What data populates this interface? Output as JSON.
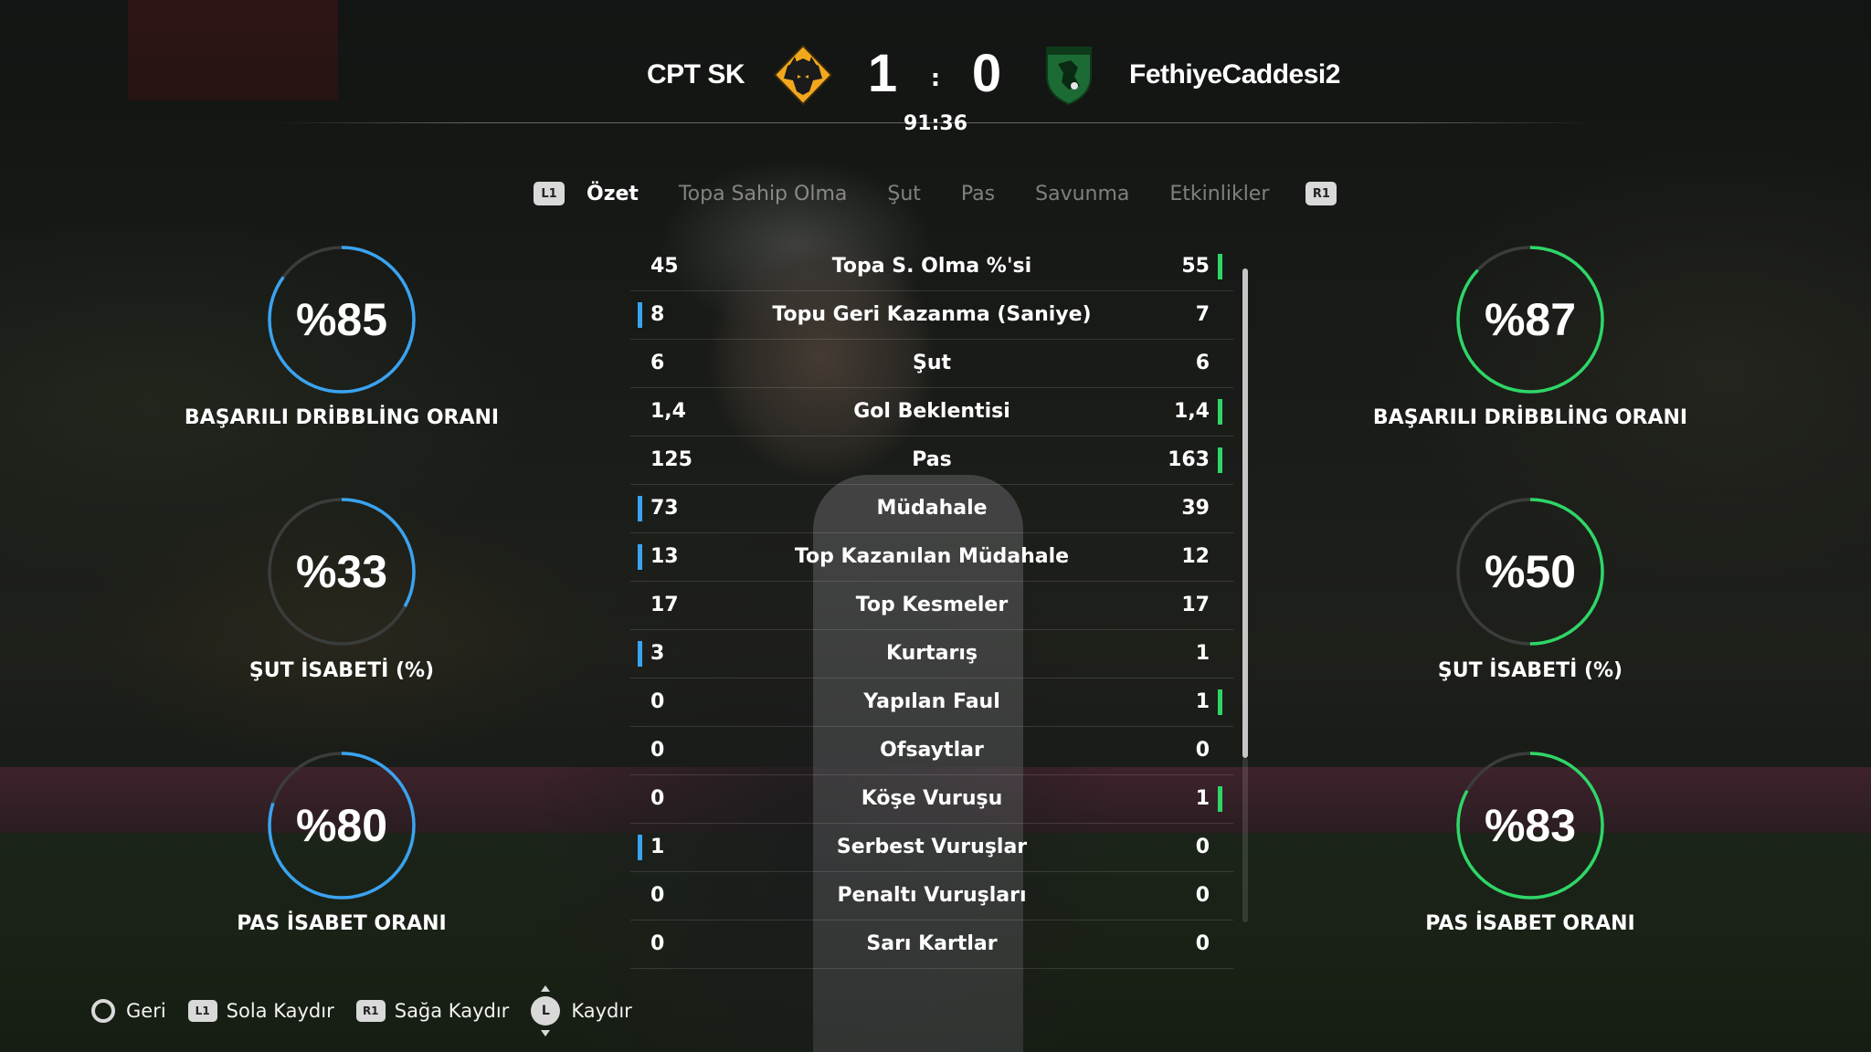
{
  "header": {
    "home_team": "CPT SK",
    "away_team": "FethiyeCaddesi2",
    "home_score": "1",
    "away_score": "0",
    "score_separator": ":",
    "clock": "91:36"
  },
  "tabs": {
    "prev_button": "L1",
    "next_button": "R1",
    "items": [
      "Özet",
      "Topa Sahip Olma",
      "Şut",
      "Pas",
      "Savunma",
      "Etkinlikler"
    ],
    "active": "Özet"
  },
  "stats": [
    {
      "label": "Topa S. Olma %'si",
      "home": "45",
      "away": "55",
      "leader": "away"
    },
    {
      "label": "Topu Geri Kazanma (Saniye)",
      "home": "8",
      "away": "7",
      "leader": "home"
    },
    {
      "label": "Şut",
      "home": "6",
      "away": "6",
      "leader": "none"
    },
    {
      "label": "Gol Beklentisi",
      "home": "1,4",
      "away": "1,4",
      "leader": "away"
    },
    {
      "label": "Pas",
      "home": "125",
      "away": "163",
      "leader": "away"
    },
    {
      "label": "Müdahale",
      "home": "73",
      "away": "39",
      "leader": "home"
    },
    {
      "label": "Top Kazanılan Müdahale",
      "home": "13",
      "away": "12",
      "leader": "home"
    },
    {
      "label": "Top Kesmeler",
      "home": "17",
      "away": "17",
      "leader": "none"
    },
    {
      "label": "Kurtarış",
      "home": "3",
      "away": "1",
      "leader": "home"
    },
    {
      "label": "Yapılan Faul",
      "home": "0",
      "away": "1",
      "leader": "away"
    },
    {
      "label": "Ofsaytlar",
      "home": "0",
      "away": "0",
      "leader": "none"
    },
    {
      "label": "Köşe Vuruşu",
      "home": "0",
      "away": "1",
      "leader": "away"
    },
    {
      "label": "Serbest Vuruşlar",
      "home": "1",
      "away": "0",
      "leader": "home"
    },
    {
      "label": "Penaltı Vuruşları",
      "home": "0",
      "away": "0",
      "leader": "none"
    },
    {
      "label": "Sarı Kartlar",
      "home": "0",
      "away": "0",
      "leader": "none"
    }
  ],
  "home_rings": [
    {
      "value_text": "%85",
      "fraction": 0.85,
      "label": "BAŞARILI DRİBBLİNG ORANI"
    },
    {
      "value_text": "%33",
      "fraction": 0.33,
      "label": "ŞUT İSABETİ (%)"
    },
    {
      "value_text": "%80",
      "fraction": 0.8,
      "label": "PAS İSABET ORANI"
    }
  ],
  "away_rings": [
    {
      "value_text": "%87",
      "fraction": 0.87,
      "label": "BAŞARILI DRİBBLİNG ORANI"
    },
    {
      "value_text": "%50",
      "fraction": 0.5,
      "label": "ŞUT İSABETİ (%)"
    },
    {
      "value_text": "%83",
      "fraction": 0.83,
      "label": "PAS İSABET ORANI"
    }
  ],
  "footer": {
    "back": {
      "button": "circle-button-icon",
      "label": "Geri"
    },
    "left": {
      "button": "L1",
      "label": "Sola Kaydır"
    },
    "right": {
      "button": "R1",
      "label": "Sağa Kaydır"
    },
    "scroll": {
      "button": "L",
      "label": "Kaydır"
    }
  },
  "colors": {
    "home_accent": "#3aa3f0",
    "away_accent": "#2ed667",
    "ring_track": "#3a3d3b"
  }
}
